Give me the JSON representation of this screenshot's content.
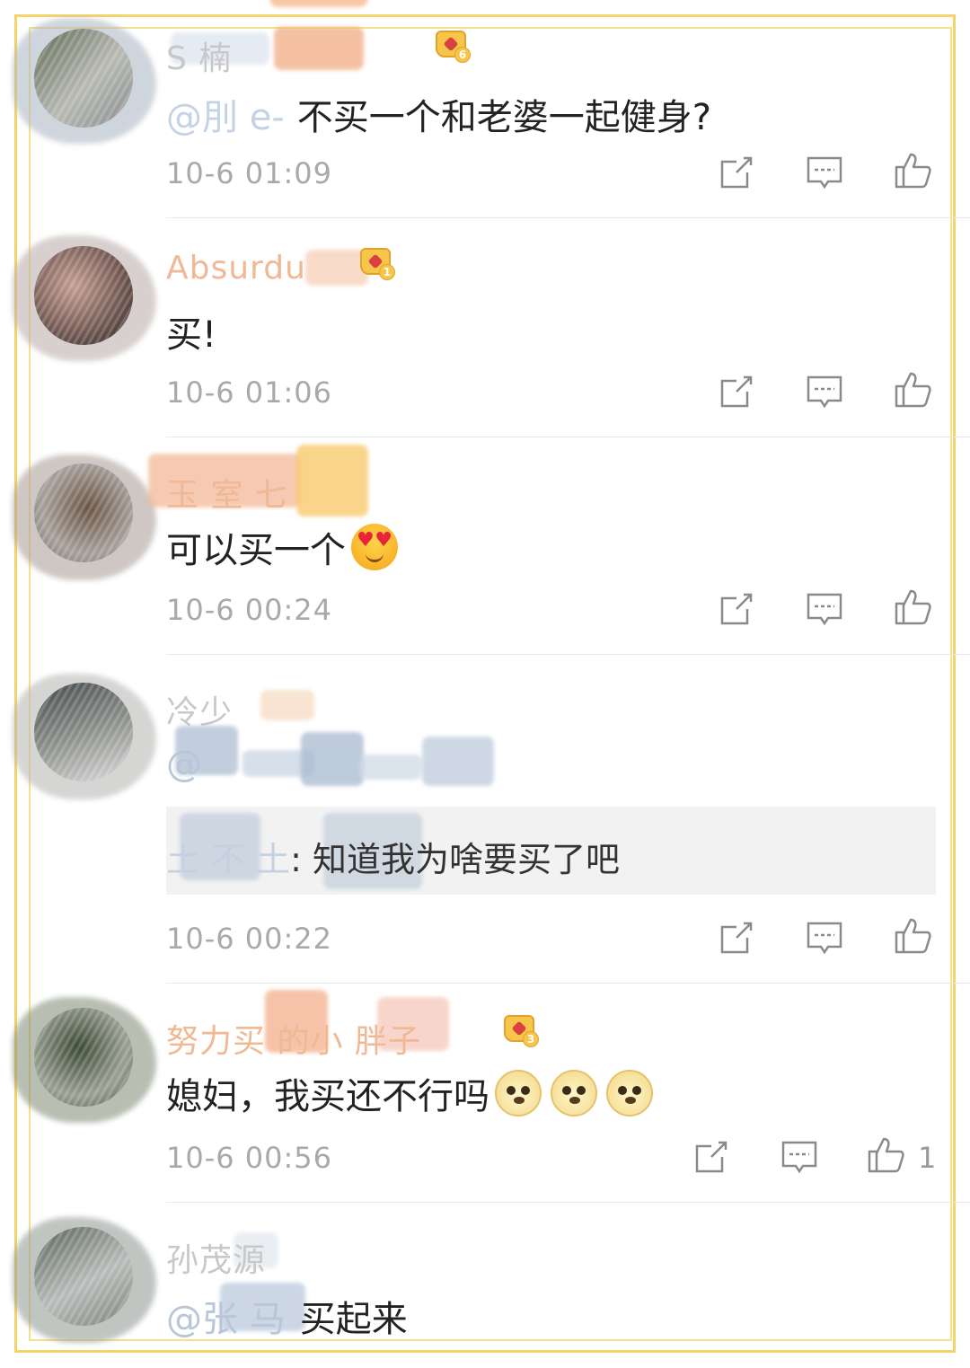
{
  "colors": {
    "accent_frame": "#f3d36b",
    "time_text": "#a9a9a9",
    "body_text": "#222222",
    "quote_bg": "#f2f2f2"
  },
  "icons": {
    "share": "share-icon",
    "reply": "comment-icon",
    "like": "thumbs-up-icon",
    "badge": "vip-crown-badge-icon"
  },
  "comments": [
    {
      "name": "S 楠",
      "badge_level": "6",
      "text_prefix": "@刖 e-",
      "text": "不买一个和老婆一起健身?",
      "time": "10-6 01:09"
    },
    {
      "name": "Absurdu",
      "badge_level": "1",
      "text": "买!",
      "time": "10-6 01:06"
    },
    {
      "name": "玉 室 七",
      "text": "可以买一个",
      "emoji": "heart-eyes-drooling-emoji",
      "time": "10-6 00:24"
    },
    {
      "name": "冷少",
      "mention": "@",
      "quote_name": "土 不 土",
      "quote_text": ": 知道我为啥要买了吧",
      "time": "10-6 00:22"
    },
    {
      "name": "努力买 的小 胖子",
      "badge_level": "3",
      "text": "媳妇，我买还不行吗",
      "emoji": "doge-emoji",
      "time": "10-6 00:56",
      "like_count": "1"
    },
    {
      "name": "孙茂源",
      "mention": "@张 马",
      "text": "买起来"
    }
  ]
}
